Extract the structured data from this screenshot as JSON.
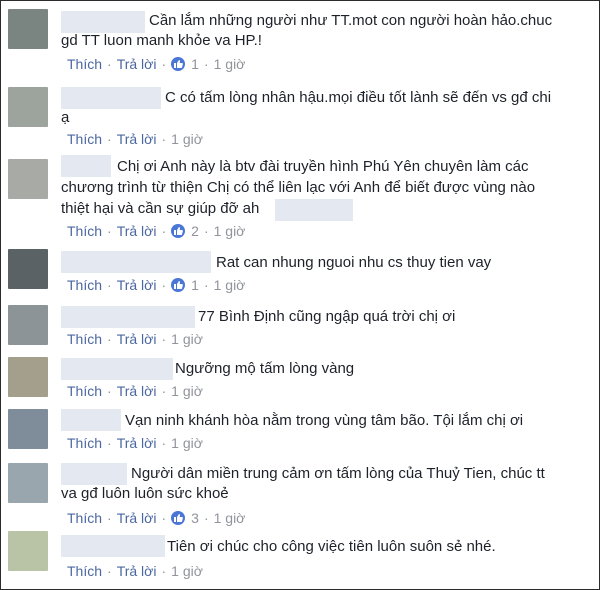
{
  "actions": {
    "like_label": "Thích",
    "reply_label": "Trả lời",
    "dot": "·"
  },
  "comments": [
    {
      "text": "Cần lắm những người như TT.mot con người hoàn hảo.chuc gd TT luon manh khỏe va HP.!",
      "likes": "1",
      "time": "1 giờ",
      "avatar_color": "#7a8480"
    },
    {
      "text": "C có tấm lòng nhân hậu.mọi điều tốt lành sẽ đến vs gđ chi ạ",
      "likes": "",
      "time": "1 giờ",
      "avatar_color": "#9da39d"
    },
    {
      "text": "Chị ơi Anh này là btv đài truyền hình Phú Yên chuyên làm các chương trình từ thiện Chị có thể liên lạc với Anh để biết được vùng nào thiệt hại và cần sự giúp đỡ ah",
      "likes": "2",
      "time": "1 giờ",
      "avatar_color": "#a8aaa6"
    },
    {
      "text": "Rat can nhung nguoi nhu cs thuy tien vay",
      "likes": "1",
      "time": "1 giờ",
      "avatar_color": "#5b6266"
    },
    {
      "text": "77 Bình Định cũng ngập quá trời chị ơi",
      "likes": "",
      "time": "1 giờ",
      "avatar_color": "#8d9498"
    },
    {
      "text": "Ngưỡng mộ tấm lòng vàng",
      "likes": "",
      "time": "1 giờ",
      "avatar_color": "#a49f8d"
    },
    {
      "text": "Vạn ninh khánh hòa nằm trong vùng tâm bão. Tội lắm chị ơi",
      "likes": "",
      "time": "1 giờ",
      "avatar_color": "#7f8c99"
    },
    {
      "text": "Người dân miền trung cảm ơn tấm lòng của Thuỷ Tien, chúc tt va gđ luôn luôn sức khoẻ",
      "likes": "3",
      "time": "1 giờ",
      "avatar_color": "#9aa6ad"
    },
    {
      "text": "Tiên ơi chúc cho công việc tiên luôn suôn sẻ nhé.",
      "likes": "",
      "time": "1 giờ",
      "avatar_color": "#b9c4a6"
    }
  ]
}
